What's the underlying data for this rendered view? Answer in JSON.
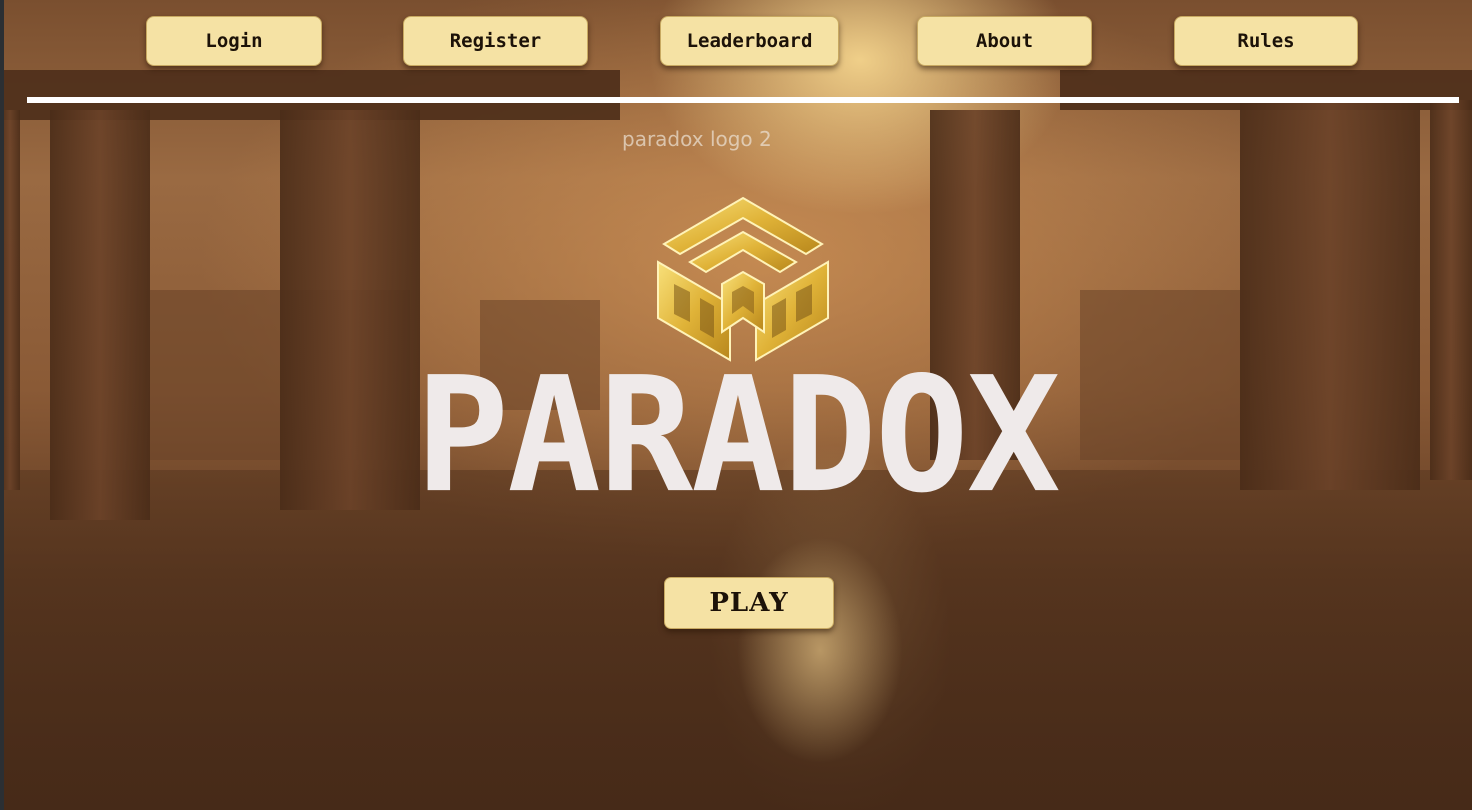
{
  "nav": {
    "items": [
      {
        "label": "Login"
      },
      {
        "label": "Register"
      },
      {
        "label": "Leaderboard"
      },
      {
        "label": "About"
      },
      {
        "label": "Rules"
      }
    ]
  },
  "hero": {
    "logo_alt_text": "paradox logo 2",
    "wordmark": "PARADOX",
    "play_label": "PLAY"
  },
  "colors": {
    "button_bg": "#f5e2a4",
    "button_border": "#c8a961",
    "emblem_gold": "#e6bf3f",
    "wordmark": "#efeaea",
    "divider": "#ffffff"
  },
  "icons": {
    "emblem": "paradox-cube-emblem"
  }
}
